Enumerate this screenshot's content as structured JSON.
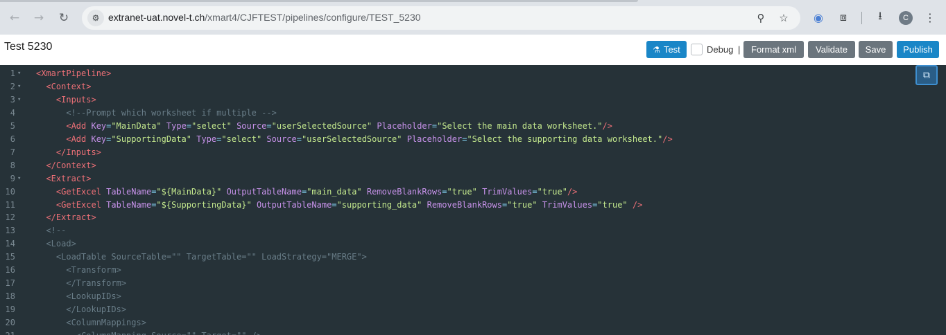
{
  "browser": {
    "url_host": "extranet-uat.novel-t.ch",
    "url_path": "/xmart4/CJFTEST/pipelines/configure/TEST_5230",
    "nav": {
      "back_icon": "arrow-left",
      "forward_icon": "arrow-right",
      "reload_icon": "reload"
    },
    "avatar_letter": "C"
  },
  "header": {
    "title": "Test 5230",
    "test_label": "Test",
    "debug_label": "Debug",
    "debug_separator": "|",
    "format_label": "Format xml",
    "validate_label": "Validate",
    "save_label": "Save",
    "publish_label": "Publish"
  },
  "colors": {
    "primary": "#1a86c7",
    "secondary": "#6b757d",
    "editor_bg": "#263238"
  },
  "editor": {
    "lines": [
      {
        "n": "1",
        "fold": true,
        "segs": [
          [
            "t",
            "<XmartPipeline>"
          ]
        ]
      },
      {
        "n": "2",
        "fold": true,
        "segs": [
          [
            "p",
            "  "
          ],
          [
            "t",
            "<Context>"
          ]
        ]
      },
      {
        "n": "3",
        "fold": true,
        "segs": [
          [
            "p",
            "    "
          ],
          [
            "t",
            "<Inputs>"
          ]
        ]
      },
      {
        "n": "4",
        "fold": false,
        "segs": [
          [
            "p",
            "      "
          ],
          [
            "c",
            "<!--Prompt which worksheet if multiple -->"
          ]
        ]
      },
      {
        "n": "5",
        "fold": false,
        "segs": [
          [
            "p",
            "      "
          ],
          [
            "t",
            "<Add "
          ],
          [
            "a",
            "Key"
          ],
          [
            "e",
            "="
          ],
          [
            "s",
            "\"MainData\""
          ],
          [
            "p",
            " "
          ],
          [
            "a",
            "Type"
          ],
          [
            "e",
            "="
          ],
          [
            "s",
            "\"select\""
          ],
          [
            "p",
            " "
          ],
          [
            "a",
            "Source"
          ],
          [
            "e",
            "="
          ],
          [
            "s",
            "\"userSelectedSource\""
          ],
          [
            "p",
            " "
          ],
          [
            "a",
            "Placeholder"
          ],
          [
            "e",
            "="
          ],
          [
            "s",
            "\"Select the main data worksheet.\""
          ],
          [
            "t",
            "/>"
          ]
        ]
      },
      {
        "n": "6",
        "fold": false,
        "segs": [
          [
            "p",
            "      "
          ],
          [
            "t",
            "<Add "
          ],
          [
            "a",
            "Key"
          ],
          [
            "e",
            "="
          ],
          [
            "s",
            "\"SupportingData\""
          ],
          [
            "p",
            " "
          ],
          [
            "a",
            "Type"
          ],
          [
            "e",
            "="
          ],
          [
            "s",
            "\"select\""
          ],
          [
            "p",
            " "
          ],
          [
            "a",
            "Source"
          ],
          [
            "e",
            "="
          ],
          [
            "s",
            "\"userSelectedSource\""
          ],
          [
            "p",
            " "
          ],
          [
            "a",
            "Placeholder"
          ],
          [
            "e",
            "="
          ],
          [
            "s",
            "\"Select the supporting data worksheet.\""
          ],
          [
            "t",
            "/>"
          ]
        ]
      },
      {
        "n": "7",
        "fold": false,
        "segs": [
          [
            "p",
            "    "
          ],
          [
            "t",
            "</Inputs>"
          ]
        ]
      },
      {
        "n": "8",
        "fold": false,
        "segs": [
          [
            "p",
            "  "
          ],
          [
            "t",
            "</Context>"
          ]
        ]
      },
      {
        "n": "9",
        "fold": true,
        "segs": [
          [
            "p",
            "  "
          ],
          [
            "t",
            "<Extract>"
          ]
        ]
      },
      {
        "n": "10",
        "fold": false,
        "segs": [
          [
            "p",
            "    "
          ],
          [
            "t",
            "<GetExcel "
          ],
          [
            "a",
            "TableName"
          ],
          [
            "e",
            "="
          ],
          [
            "s",
            "\"${MainData}\""
          ],
          [
            "p",
            " "
          ],
          [
            "a",
            "OutputTableName"
          ],
          [
            "e",
            "="
          ],
          [
            "s",
            "\"main_data\""
          ],
          [
            "p",
            " "
          ],
          [
            "a",
            "RemoveBlankRows"
          ],
          [
            "e",
            "="
          ],
          [
            "s",
            "\"true\""
          ],
          [
            "p",
            " "
          ],
          [
            "a",
            "TrimValues"
          ],
          [
            "e",
            "="
          ],
          [
            "s",
            "\"true\""
          ],
          [
            "t",
            "/>"
          ]
        ]
      },
      {
        "n": "11",
        "fold": false,
        "segs": [
          [
            "p",
            "    "
          ],
          [
            "t",
            "<GetExcel "
          ],
          [
            "a",
            "TableName"
          ],
          [
            "e",
            "="
          ],
          [
            "s",
            "\"${SupportingData}\""
          ],
          [
            "p",
            " "
          ],
          [
            "a",
            "OutputTableName"
          ],
          [
            "e",
            "="
          ],
          [
            "s",
            "\"supporting_data\""
          ],
          [
            "p",
            " "
          ],
          [
            "a",
            "RemoveBlankRows"
          ],
          [
            "e",
            "="
          ],
          [
            "s",
            "\"true\""
          ],
          [
            "p",
            " "
          ],
          [
            "a",
            "TrimValues"
          ],
          [
            "e",
            "="
          ],
          [
            "s",
            "\"true\""
          ],
          [
            "p",
            " "
          ],
          [
            "t",
            "/>"
          ]
        ]
      },
      {
        "n": "12",
        "fold": false,
        "segs": [
          [
            "p",
            "  "
          ],
          [
            "t",
            "</Extract>"
          ]
        ]
      },
      {
        "n": "13",
        "fold": false,
        "segs": [
          [
            "p",
            "  "
          ],
          [
            "c",
            "<!--"
          ]
        ]
      },
      {
        "n": "14",
        "fold": false,
        "segs": [
          [
            "p",
            "  "
          ],
          [
            "c",
            "<Load>"
          ]
        ]
      },
      {
        "n": "15",
        "fold": false,
        "segs": [
          [
            "p",
            "    "
          ],
          [
            "c",
            "<LoadTable SourceTable=\"\" TargetTable=\"\" LoadStrategy=\"MERGE\">"
          ]
        ]
      },
      {
        "n": "16",
        "fold": false,
        "segs": [
          [
            "p",
            "      "
          ],
          [
            "c",
            "<Transform>"
          ]
        ]
      },
      {
        "n": "17",
        "fold": false,
        "segs": [
          [
            "p",
            "      "
          ],
          [
            "c",
            "</Transform>"
          ]
        ]
      },
      {
        "n": "18",
        "fold": false,
        "segs": [
          [
            "p",
            "      "
          ],
          [
            "c",
            "<LookupIDs>"
          ]
        ]
      },
      {
        "n": "19",
        "fold": false,
        "segs": [
          [
            "p",
            "      "
          ],
          [
            "c",
            "</LookupIDs>"
          ]
        ]
      },
      {
        "n": "20",
        "fold": false,
        "segs": [
          [
            "p",
            "      "
          ],
          [
            "c",
            "<ColumnMappings>"
          ]
        ]
      },
      {
        "n": "21",
        "fold": false,
        "segs": [
          [
            "p",
            "        "
          ],
          [
            "c",
            "<ColumnMapping Source=\"\" Target=\"\" />"
          ]
        ]
      }
    ]
  }
}
